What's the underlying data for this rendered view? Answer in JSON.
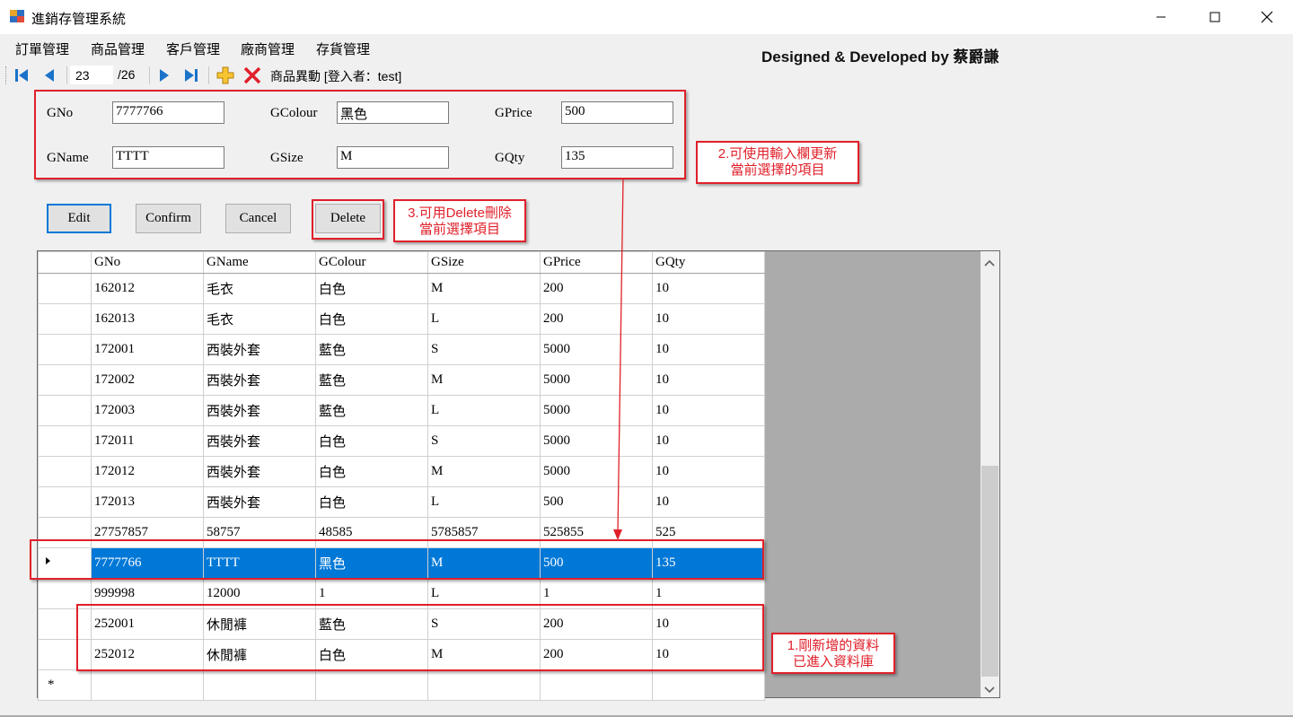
{
  "window": {
    "title": "進銷存管理系統"
  },
  "menu": [
    "訂單管理",
    "商品管理",
    "客戶管理",
    "廠商管理",
    "存貨管理"
  ],
  "designer": "Designed & Developed by 蔡爵謙",
  "toolbar": {
    "position": "23",
    "total": "/26",
    "label": "商品異動  [登入者：test]"
  },
  "form": {
    "gno_label": "GNo",
    "gno": "7777766",
    "gname_label": "GName",
    "gname": "TTTT",
    "gcolour_label": "GColour",
    "gcolour": "黑色",
    "gsize_label": "GSize",
    "gsize": "M",
    "gprice_label": "GPrice",
    "gprice": "500",
    "gqty_label": "GQty",
    "gqty": "135"
  },
  "buttons": {
    "edit": "Edit",
    "confirm": "Confirm",
    "cancel": "Cancel",
    "delete": "Delete"
  },
  "notes": {
    "note2_l1": "2.可使用輸入欄更新",
    "note2_l2": "當前選擇的項目",
    "note3_l1": "3.可用Delete刪除",
    "note3_l2": "當前選擇項目",
    "note1_l1": "1.剛新增的資料",
    "note1_l2": "已進入資料庫"
  },
  "grid": {
    "columns": [
      "GNo",
      "GName",
      "GColour",
      "GSize",
      "GPrice",
      "GQty"
    ],
    "rows": [
      [
        "162012",
        "毛衣",
        "白色",
        "M",
        "200",
        "10"
      ],
      [
        "162013",
        "毛衣",
        "白色",
        "L",
        "200",
        "10"
      ],
      [
        "172001",
        "西裝外套",
        "藍色",
        "S",
        "5000",
        "10"
      ],
      [
        "172002",
        "西裝外套",
        "藍色",
        "M",
        "5000",
        "10"
      ],
      [
        "172003",
        "西裝外套",
        "藍色",
        "L",
        "5000",
        "10"
      ],
      [
        "172011",
        "西裝外套",
        "白色",
        "S",
        "5000",
        "10"
      ],
      [
        "172012",
        "西裝外套",
        "白色",
        "M",
        "5000",
        "10"
      ],
      [
        "172013",
        "西裝外套",
        "白色",
        "L",
        "500",
        "10"
      ],
      [
        "27757857",
        "58757",
        "48585",
        "5785857",
        "525855",
        "525"
      ],
      [
        "7777766",
        "TTTT",
        "黑色",
        "M",
        "500",
        "135"
      ],
      [
        "999998",
        "12000",
        "1",
        "L",
        "1",
        "1"
      ],
      [
        "252001",
        "休閒褲",
        "藍色",
        "S",
        "200",
        "10"
      ],
      [
        "252012",
        "休閒褲",
        "白色",
        "M",
        "200",
        "10"
      ]
    ],
    "selected_index": 9,
    "new_row_marker": "*"
  },
  "colors": {
    "accent": "#0078d7",
    "note_red": "#e0202a",
    "toolbar_blue": "#1a73c9"
  }
}
